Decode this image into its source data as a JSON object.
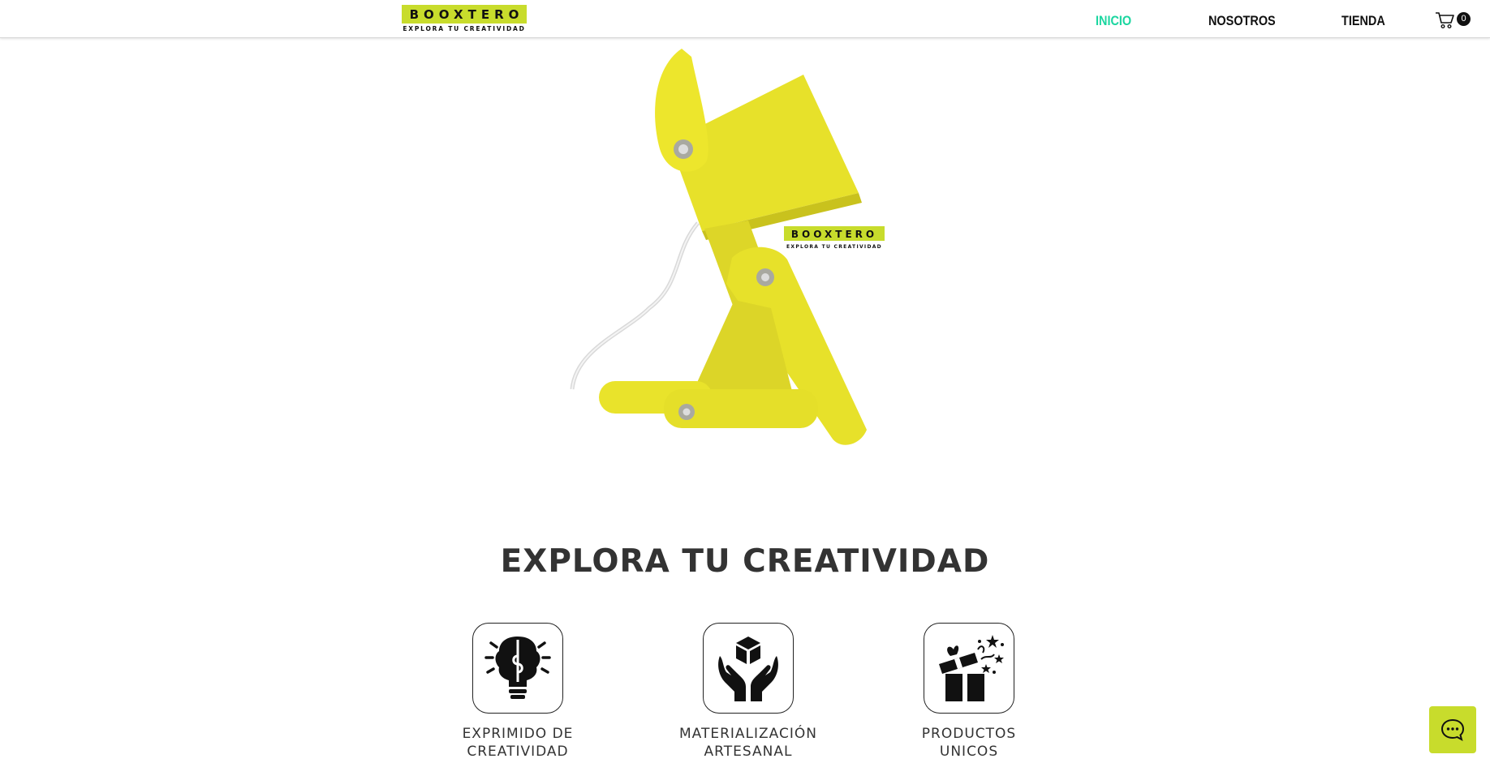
{
  "header": {
    "logo_text": "BOOXTERO",
    "logo_tagline": "EXPLORA TU CREATIVIDAD",
    "nav": [
      {
        "label": "INICIO",
        "active": true
      },
      {
        "label": "NOSOTROS",
        "active": false
      },
      {
        "label": "TIENDA",
        "active": false
      }
    ],
    "cart_count": "0"
  },
  "hero": {
    "logo_text": "BOOXTERO",
    "logo_tagline": "EXPLORA TU CREATIVIDAD"
  },
  "main": {
    "headline": "EXPLORA TU CREATIVIDAD",
    "features": [
      {
        "label_line1": "EXPRIMIDO DE",
        "label_line2": "CREATIVIDAD",
        "icon": "lightbulb-brain-icon"
      },
      {
        "label_line1": "MATERIALIZACIÓN",
        "label_line2": "ARTESANAL",
        "icon": "hands-box-icon"
      },
      {
        "label_line1": "PRODUCTOS",
        "label_line2": "UNICOS",
        "icon": "gift-box-icon"
      }
    ]
  },
  "colors": {
    "brand_yellow": "#c8dc2c",
    "active_nav": "#1bd6a0",
    "lamp_yellow": "#e8e22a"
  },
  "chat": {
    "icon": "chat-bubble-icon"
  }
}
